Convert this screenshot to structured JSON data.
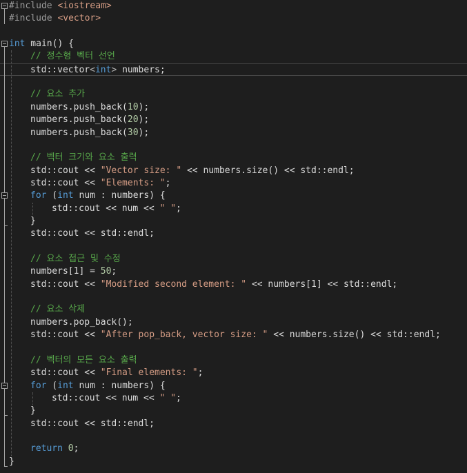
{
  "editor": {
    "colors": {
      "background": "#1e1e1e",
      "keyword": "#569cd6",
      "comment": "#57a64a",
      "string": "#d69d85",
      "number": "#b5cea8",
      "text": "#dcdcdc",
      "preprocessor": "#9b9b9b"
    },
    "lines": [
      {
        "indent": 0,
        "tokens": [
          [
            "pp",
            "#include "
          ],
          [
            "inc",
            "<iostream>"
          ]
        ]
      },
      {
        "indent": 0,
        "tokens": [
          [
            "pp",
            "#include "
          ],
          [
            "inc",
            "<vector>"
          ]
        ]
      },
      {
        "indent": 0,
        "tokens": []
      },
      {
        "indent": 0,
        "tokens": [
          [
            "kw",
            "int"
          ],
          [
            "id",
            " main() {"
          ]
        ]
      },
      {
        "indent": 1,
        "tokens": [
          [
            "cmt",
            "// 정수형 벡터 선언"
          ]
        ]
      },
      {
        "indent": 1,
        "tokens": [
          [
            "id",
            "std::"
          ],
          [
            "id",
            "vector"
          ],
          [
            "op",
            "<"
          ],
          [
            "kw",
            "int"
          ],
          [
            "op",
            ">"
          ],
          [
            "id",
            " numbers;"
          ]
        ]
      },
      {
        "indent": 1,
        "tokens": []
      },
      {
        "indent": 1,
        "tokens": [
          [
            "cmt",
            "// 요소 추가"
          ]
        ]
      },
      {
        "indent": 1,
        "tokens": [
          [
            "id",
            "numbers.push_back("
          ],
          [
            "num",
            "10"
          ],
          [
            "id",
            ");"
          ]
        ]
      },
      {
        "indent": 1,
        "tokens": [
          [
            "id",
            "numbers.push_back("
          ],
          [
            "num",
            "20"
          ],
          [
            "id",
            ");"
          ]
        ]
      },
      {
        "indent": 1,
        "tokens": [
          [
            "id",
            "numbers.push_back("
          ],
          [
            "num",
            "30"
          ],
          [
            "id",
            ");"
          ]
        ]
      },
      {
        "indent": 1,
        "tokens": []
      },
      {
        "indent": 1,
        "tokens": [
          [
            "cmt",
            "// 벡터 크기와 요소 출력"
          ]
        ]
      },
      {
        "indent": 1,
        "tokens": [
          [
            "id",
            "std::cout << "
          ],
          [
            "str",
            "\"Vector size: \""
          ],
          [
            "id",
            " << numbers.size() << std::endl;"
          ]
        ]
      },
      {
        "indent": 1,
        "tokens": [
          [
            "id",
            "std::cout << "
          ],
          [
            "str",
            "\"Elements: \""
          ],
          [
            "id",
            ";"
          ]
        ]
      },
      {
        "indent": 1,
        "tokens": [
          [
            "kw",
            "for"
          ],
          [
            "id",
            " ("
          ],
          [
            "kw",
            "int"
          ],
          [
            "id",
            " num : numbers) {"
          ]
        ]
      },
      {
        "indent": 2,
        "tokens": [
          [
            "id",
            "std::cout << num << "
          ],
          [
            "str",
            "\" \""
          ],
          [
            "id",
            ";"
          ]
        ]
      },
      {
        "indent": 1,
        "tokens": [
          [
            "id",
            "}"
          ]
        ]
      },
      {
        "indent": 1,
        "tokens": [
          [
            "id",
            "std::cout << std::endl;"
          ]
        ]
      },
      {
        "indent": 1,
        "tokens": []
      },
      {
        "indent": 1,
        "tokens": [
          [
            "cmt",
            "// 요소 접근 및 수정"
          ]
        ]
      },
      {
        "indent": 1,
        "tokens": [
          [
            "id",
            "numbers[1] = "
          ],
          [
            "num",
            "50"
          ],
          [
            "id",
            ";"
          ]
        ]
      },
      {
        "indent": 1,
        "tokens": [
          [
            "id",
            "std::cout << "
          ],
          [
            "str",
            "\"Modified second element: \""
          ],
          [
            "id",
            " << numbers[1] << std::endl;"
          ]
        ]
      },
      {
        "indent": 1,
        "tokens": []
      },
      {
        "indent": 1,
        "tokens": [
          [
            "cmt",
            "// 요소 삭제"
          ]
        ]
      },
      {
        "indent": 1,
        "tokens": [
          [
            "id",
            "numbers.pop_back();"
          ]
        ]
      },
      {
        "indent": 1,
        "tokens": [
          [
            "id",
            "std::cout << "
          ],
          [
            "str",
            "\"After pop_back, vector size: \""
          ],
          [
            "id",
            " << numbers.size() << std::endl;"
          ]
        ]
      },
      {
        "indent": 1,
        "tokens": []
      },
      {
        "indent": 1,
        "tokens": [
          [
            "cmt",
            "// 벡터의 모든 요소 출력"
          ]
        ]
      },
      {
        "indent": 1,
        "tokens": [
          [
            "id",
            "std::cout << "
          ],
          [
            "str",
            "\"Final elements: \""
          ],
          [
            "id",
            ";"
          ]
        ]
      },
      {
        "indent": 1,
        "tokens": [
          [
            "kw",
            "for"
          ],
          [
            "id",
            " ("
          ],
          [
            "kw",
            "int"
          ],
          [
            "id",
            " num : numbers) {"
          ]
        ]
      },
      {
        "indent": 2,
        "tokens": [
          [
            "id",
            "std::cout << num << "
          ],
          [
            "str",
            "\" \""
          ],
          [
            "id",
            ";"
          ]
        ]
      },
      {
        "indent": 1,
        "tokens": [
          [
            "id",
            "}"
          ]
        ]
      },
      {
        "indent": 1,
        "tokens": [
          [
            "id",
            "std::cout << std::endl;"
          ]
        ]
      },
      {
        "indent": 1,
        "tokens": []
      },
      {
        "indent": 1,
        "tokens": [
          [
            "kw",
            "return"
          ],
          [
            "id",
            " "
          ],
          [
            "num",
            "0"
          ],
          [
            "id",
            ";"
          ]
        ]
      },
      {
        "indent": 0,
        "tokens": [
          [
            "id",
            "}"
          ]
        ]
      }
    ]
  }
}
